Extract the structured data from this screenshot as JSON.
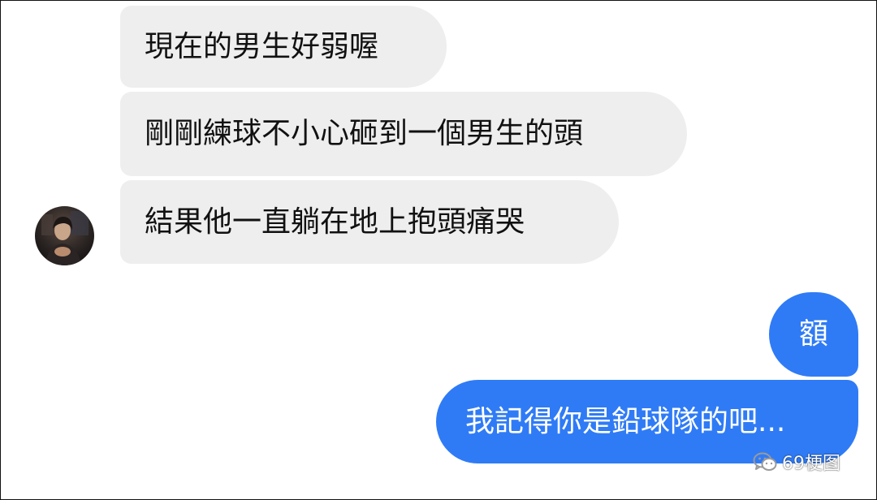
{
  "conversation": {
    "incoming": [
      {
        "text": "現在的男生好弱喔"
      },
      {
        "text": "剛剛練球不小心砸到一個男生的頭"
      },
      {
        "text": "結果他一直躺在地上抱頭痛哭"
      }
    ],
    "outgoing": [
      {
        "text": "額"
      },
      {
        "text": "我記得你是鉛球隊的吧..."
      }
    ]
  },
  "contact": {
    "avatar_icon": "avatar-photo"
  },
  "watermark": {
    "icon": "wechat-icon",
    "text": "69梗图"
  },
  "colors": {
    "incoming_bubble": "#eeeeee",
    "outgoing_bubble": "#2f7bf6",
    "incoming_text": "#111111",
    "outgoing_text": "#ffffff"
  }
}
